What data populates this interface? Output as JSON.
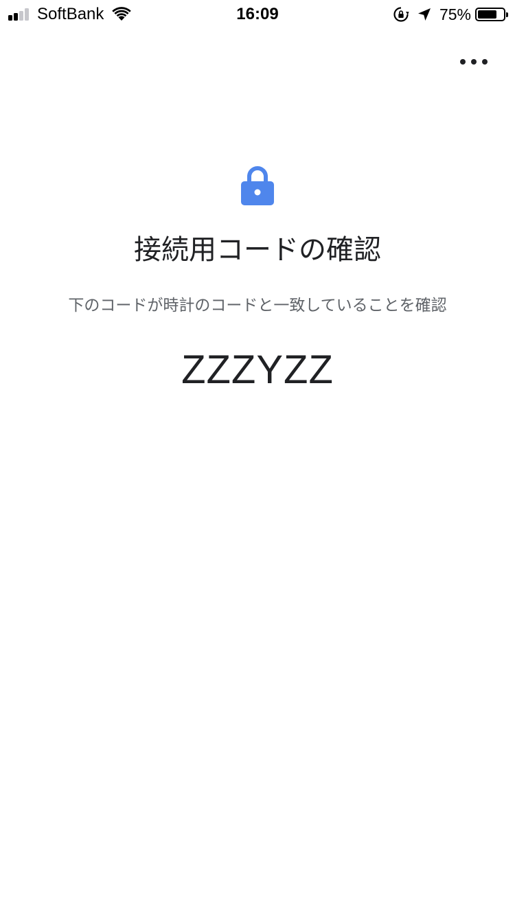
{
  "status_bar": {
    "carrier": "SoftBank",
    "time": "16:09",
    "battery_percent_text": "75%",
    "battery_level": 0.75,
    "signal_bars_total": 4,
    "signal_bars_filled": 2,
    "icons": [
      "signal-icon",
      "wifi-icon",
      "rotation-lock-icon",
      "location-arrow-icon",
      "battery-icon"
    ]
  },
  "toolbar": {
    "more_icon": "more-horiz-icon"
  },
  "content": {
    "icon": "lock-icon",
    "accent_color": "#4f86ec",
    "title": "接続用コードの確認",
    "subtitle": "下のコードが時計のコードと一致していることを確認",
    "code": "ZZZYZZ"
  }
}
